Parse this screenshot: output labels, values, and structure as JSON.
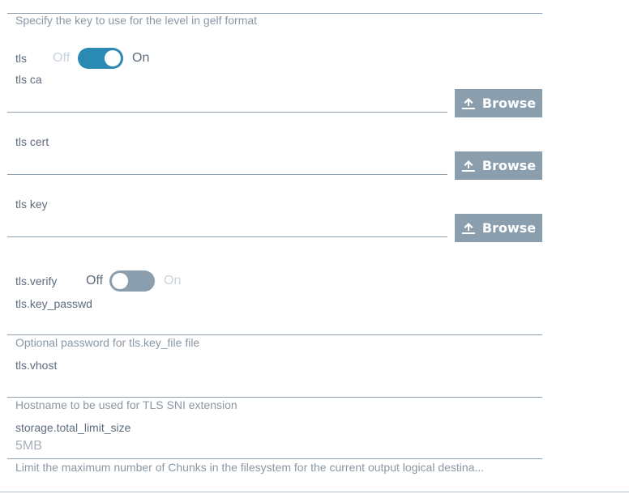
{
  "level_key": {
    "help": "Specify the key to use for the level in gelf format"
  },
  "tls": {
    "label": "tls",
    "off": "Off",
    "on": "On",
    "state": "on"
  },
  "tls_ca": {
    "label": "tls ca",
    "button": "Browse"
  },
  "tls_cert": {
    "label": "tls cert",
    "button": "Browse"
  },
  "tls_key": {
    "label": "tls key",
    "button": "Browse"
  },
  "tls_verify": {
    "label": "tls.verify",
    "off": "Off",
    "on": "On",
    "state": "off"
  },
  "tls_key_passwd": {
    "label": "tls.key_passwd",
    "value": "",
    "help": "Optional password for tls.key_file file"
  },
  "tls_vhost": {
    "label": "tls.vhost",
    "value": "",
    "help": "Hostname to be used for TLS SNI extension"
  },
  "storage_total_limit_size": {
    "label": "storage.total_limit_size",
    "value": "5MB",
    "help": "Limit the maximum number of Chunks in the filesystem for the current output logical destina..."
  },
  "icons": {
    "upload": "upload-icon"
  },
  "colors": {
    "accent": "#2a8ab3",
    "button": "#8b9ead",
    "line": "#8fa1b0"
  }
}
